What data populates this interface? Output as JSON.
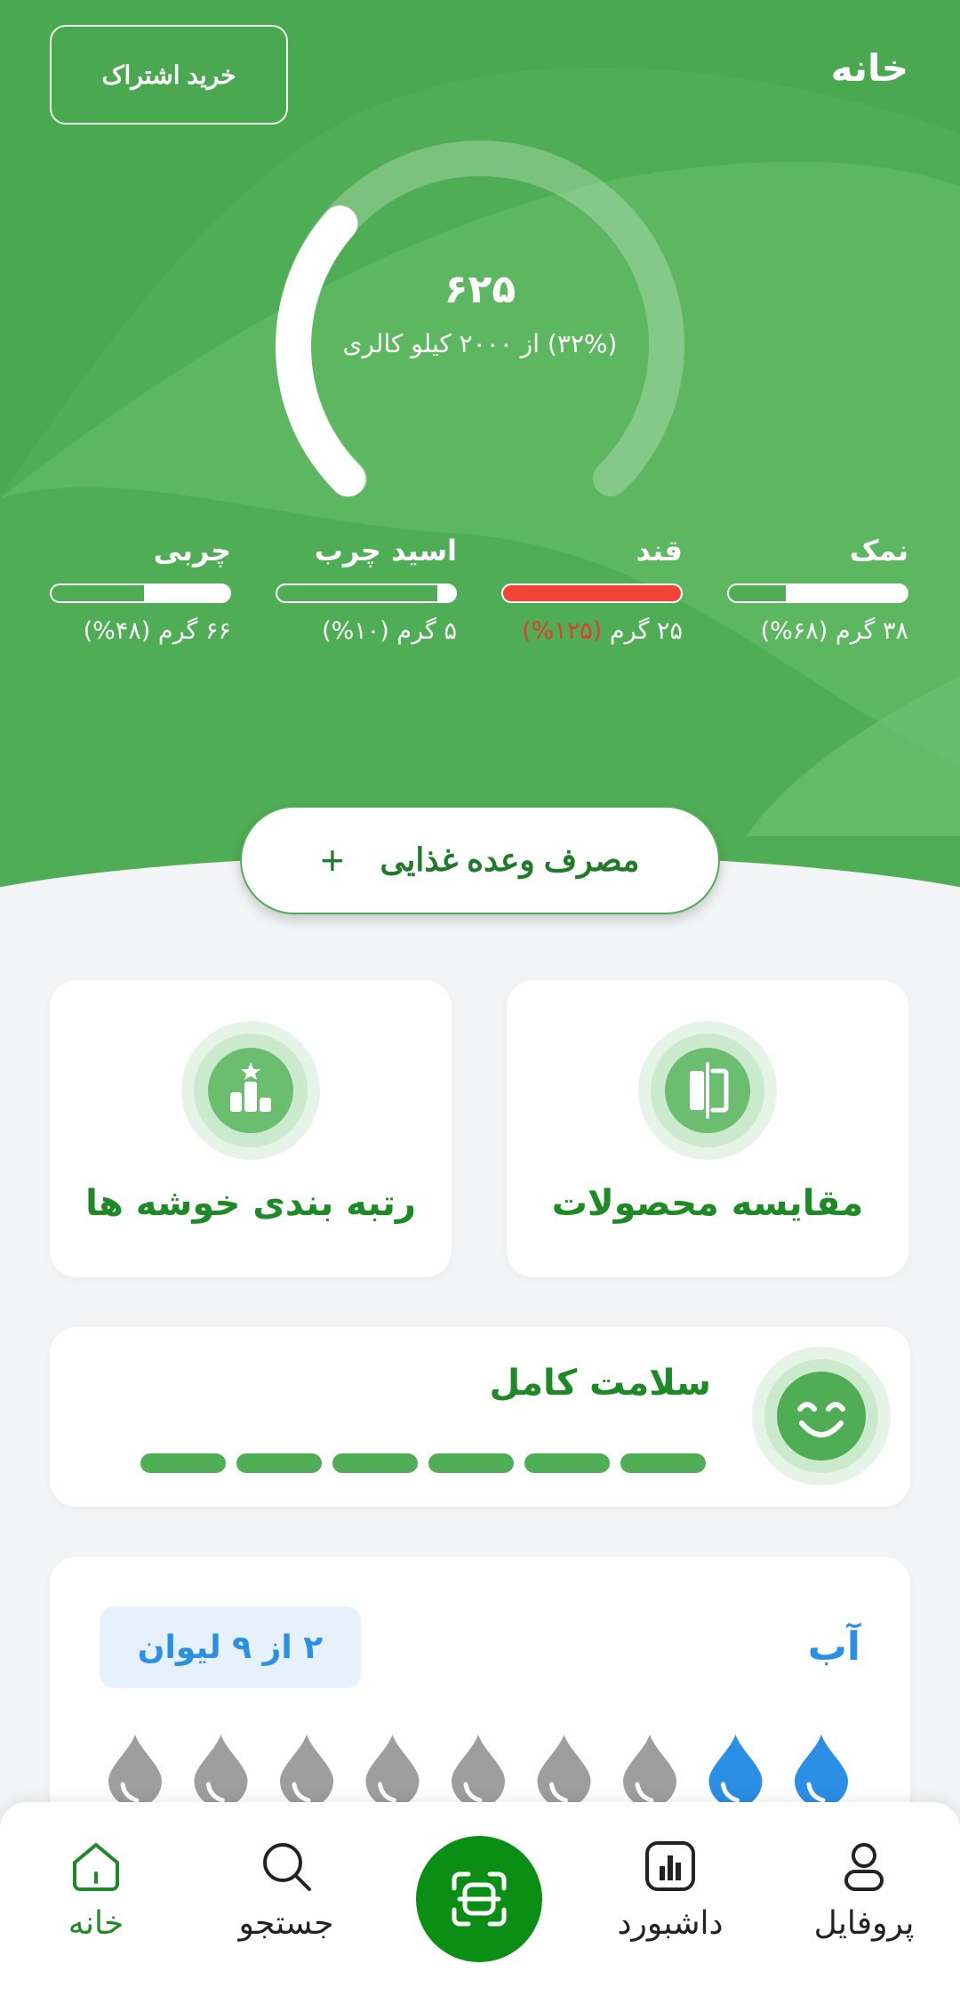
{
  "header": {
    "title": "خانه",
    "subscribe_label": "خرید اشتراک"
  },
  "calories": {
    "value": "۶۲۵",
    "subtitle": "(۳۲%) از ۲۰۰۰ کیلو کالری",
    "progress_fraction": 0.32
  },
  "nutrients": [
    {
      "name": "نمک",
      "amount": "۳۸ گرم",
      "percent": "(۶۸%)",
      "fill_fraction": 0.68,
      "over": false
    },
    {
      "name": "قند",
      "amount": "۲۵ گرم",
      "percent": "(۱۲۵%)",
      "fill_fraction": 1.0,
      "over": true
    },
    {
      "name": "اسید چرب",
      "amount": "۵ گرم",
      "percent": "(۱۰%)",
      "fill_fraction": 0.1,
      "over": false
    },
    {
      "name": "چربی",
      "amount": "۶۶ گرم",
      "percent": "(۴۸%)",
      "fill_fraction": 0.48,
      "over": false
    }
  ],
  "meal_button": {
    "label": "مصرف وعده غذایی",
    "icon": "plus-icon"
  },
  "features": [
    {
      "label": "مقایسه محصولات",
      "icon": "compare-icon"
    },
    {
      "label": "رتبه بندی خوشه ها",
      "icon": "podium-icon"
    }
  ],
  "health": {
    "title": "سلامت کامل",
    "segments_filled": 6,
    "segments_total": 6,
    "icon": "smiley-icon"
  },
  "water": {
    "title": "آب",
    "badge": "۲ از ۹ لیوان",
    "filled": 2,
    "total": 9,
    "icon": "water-drop-icon"
  },
  "nav": {
    "items": [
      {
        "label": "پروفایل",
        "icon": "user-icon"
      },
      {
        "label": "داشبورد",
        "icon": "chart-icon"
      },
      {
        "label": "",
        "icon": "scan-icon"
      },
      {
        "label": "جستجو",
        "icon": "search-icon"
      },
      {
        "label": "خانه",
        "icon": "home-icon"
      }
    ],
    "active_label": "خانه"
  },
  "colors": {
    "brand_green": "#4fae55",
    "text_green": "#1e8a25",
    "scan_green": "#0a8f14",
    "water_blue": "#2b8fe6",
    "alert_red": "#f04438"
  }
}
